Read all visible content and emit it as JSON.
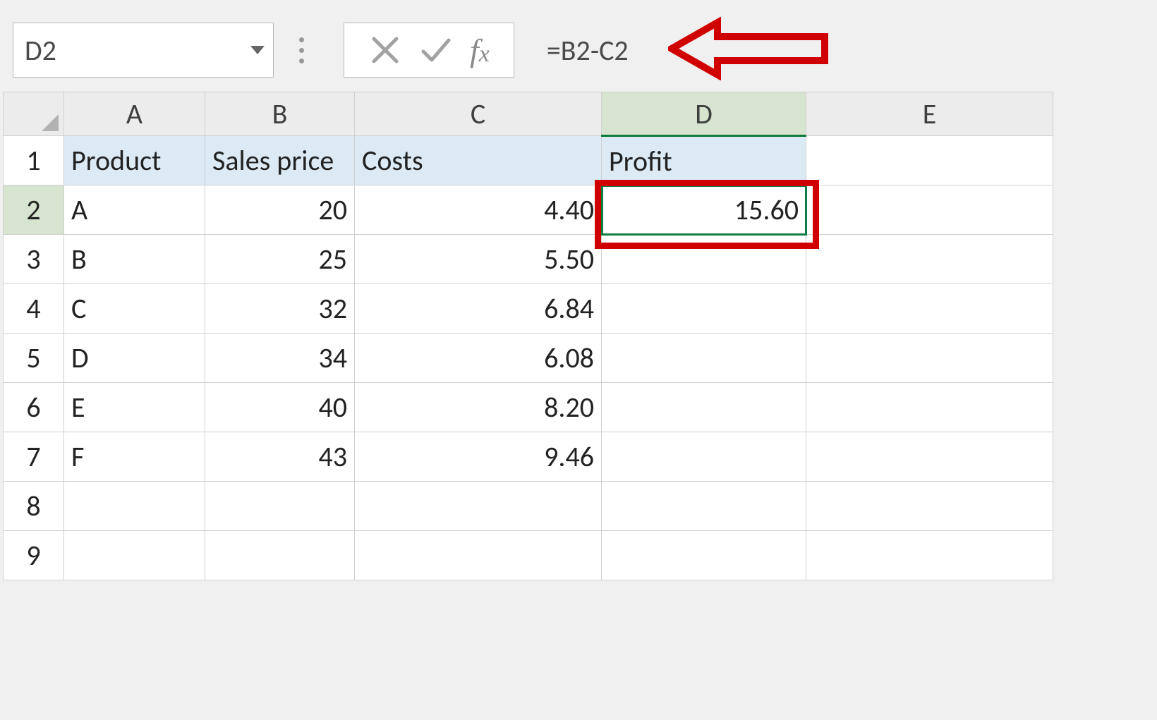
{
  "formula_bar": {
    "cell_ref": "D2",
    "formula": "=B2-C2"
  },
  "columns": [
    "A",
    "B",
    "C",
    "D",
    "E"
  ],
  "row_numbers": [
    "1",
    "2",
    "3",
    "4",
    "5",
    "6",
    "7",
    "8",
    "9"
  ],
  "active_column": "D",
  "active_row": "2",
  "active_cell": "D2",
  "headers": {
    "A": "Product",
    "B": "Sales price",
    "C": "Costs",
    "D": "Profit"
  },
  "rows": [
    {
      "A": "A",
      "B": "20",
      "C": "4.40",
      "D": "15.60"
    },
    {
      "A": "B",
      "B": "25",
      "C": "5.50",
      "D": ""
    },
    {
      "A": "C",
      "B": "32",
      "C": "6.84",
      "D": ""
    },
    {
      "A": "D",
      "B": "34",
      "C": "6.08",
      "D": ""
    },
    {
      "A": "E",
      "B": "40",
      "C": "8.20",
      "D": ""
    },
    {
      "A": "F",
      "B": "43",
      "C": "9.46",
      "D": ""
    }
  ],
  "chart_data": {
    "type": "table",
    "title": "",
    "columns": [
      "Product",
      "Sales price",
      "Costs",
      "Profit"
    ],
    "rows": [
      [
        "A",
        20,
        4.4,
        15.6
      ],
      [
        "B",
        25,
        5.5,
        null
      ],
      [
        "C",
        32,
        6.84,
        null
      ],
      [
        "D",
        34,
        6.08,
        null
      ],
      [
        "E",
        40,
        8.2,
        null
      ],
      [
        "F",
        43,
        9.46,
        null
      ]
    ]
  },
  "annotations": {
    "highlighted_cell": "D2",
    "arrow_target": "formula-input"
  },
  "colors": {
    "header_fill": "#dceaf6",
    "selection_green": "#107c41",
    "annotation_red": "#d10000"
  }
}
